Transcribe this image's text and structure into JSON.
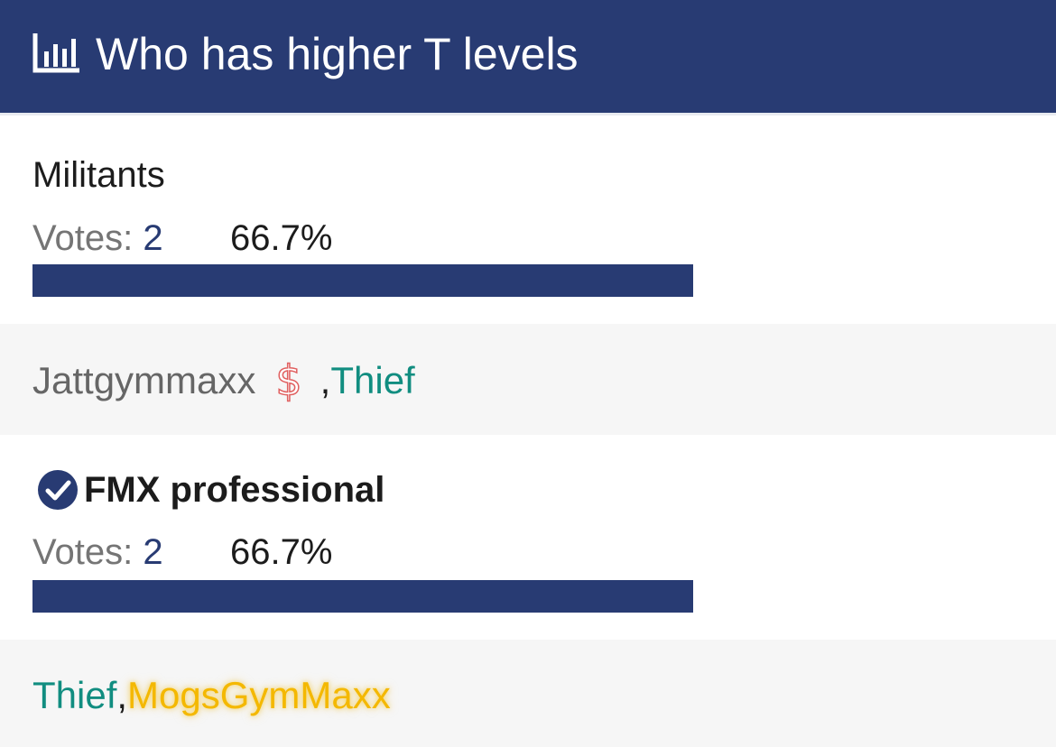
{
  "poll": {
    "title": "Who has higher T levels",
    "icon": "bar-chart-icon",
    "colors": {
      "header_bg": "#283b73",
      "bar": "#283b73",
      "teal_user": "#118d80",
      "gold_user": "#f4b800"
    }
  },
  "options": [
    {
      "label": "Militants",
      "votes_label": "Votes:",
      "votes": "2",
      "percent": "66.7%",
      "share": 0.667,
      "selected": false,
      "voters": [
        {
          "name": "Jattgymmaxx",
          "style": "gray",
          "badge": "dollar-icon"
        },
        {
          "sep": ", "
        },
        {
          "name": "Thief",
          "style": "teal"
        }
      ]
    },
    {
      "label": "FMX professional",
      "votes_label": "Votes:",
      "votes": "2",
      "percent": "66.7%",
      "share": 0.667,
      "selected": true,
      "selected_icon": "check-circle-icon",
      "voters": [
        {
          "name": "Thief",
          "style": "teal"
        },
        {
          "sep": ", "
        },
        {
          "name": "MogsGymMaxx",
          "style": "gold"
        }
      ]
    }
  ],
  "dollar_glyph": "$"
}
